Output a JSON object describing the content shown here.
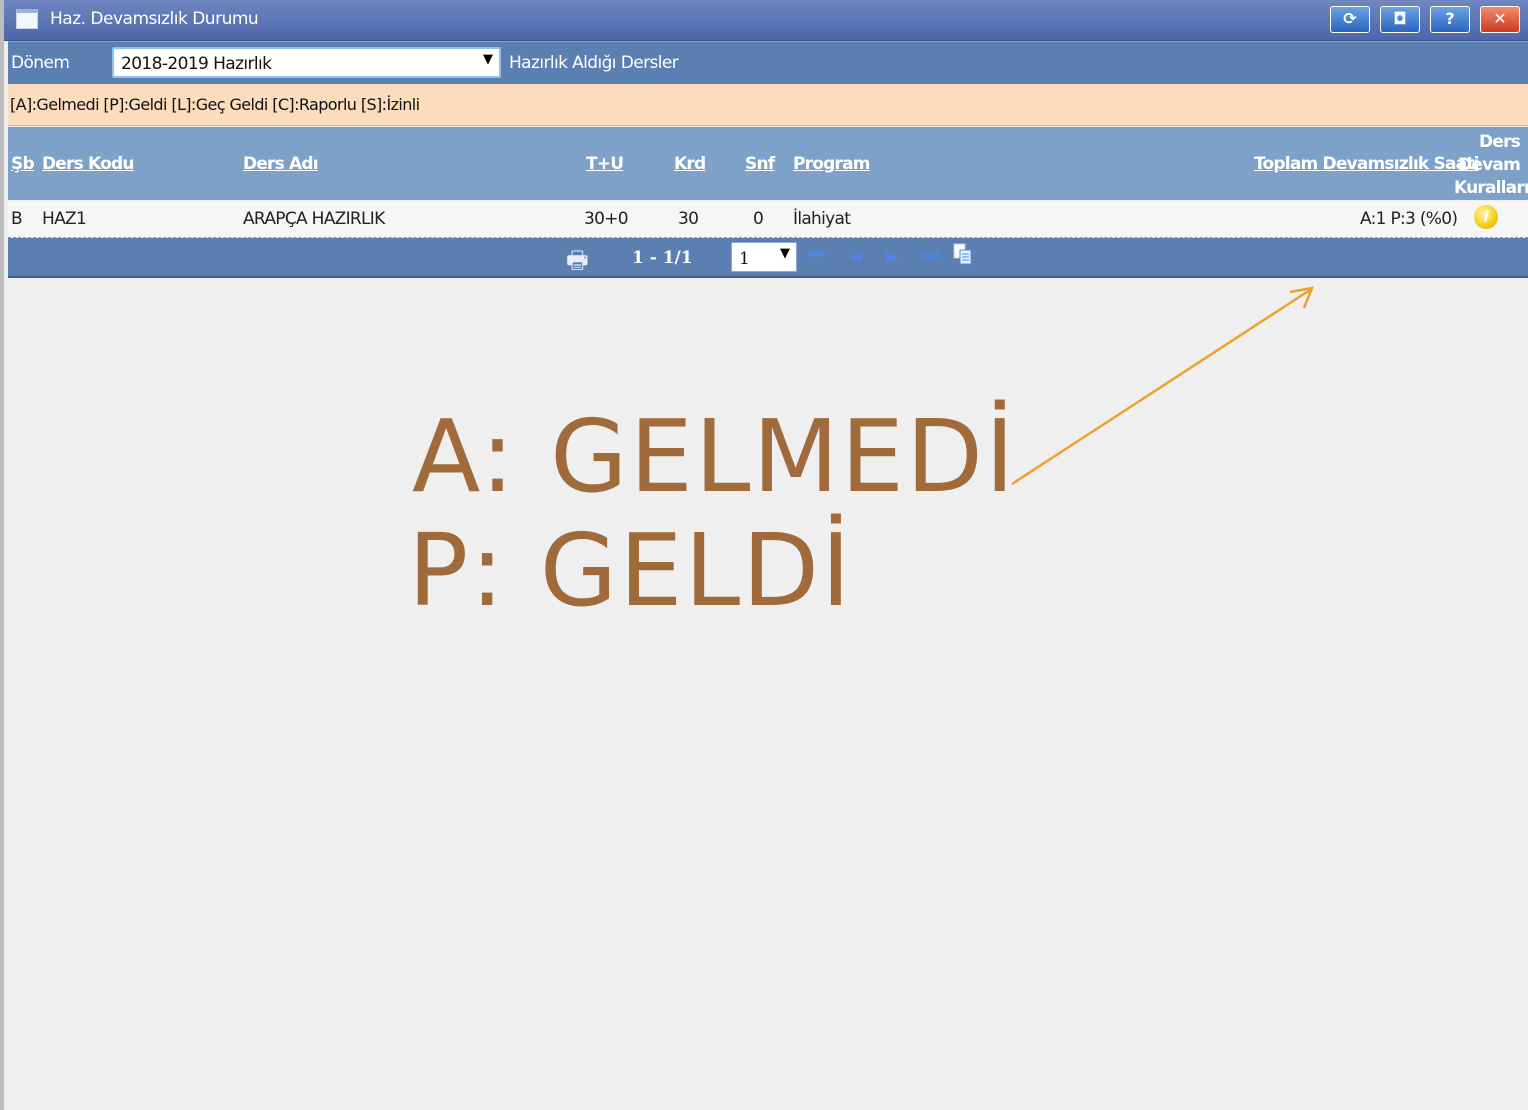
{
  "window": {
    "title": "Haz. Devamsızlık Durumu",
    "buttons": {
      "refresh": "⟳",
      "maximize": "◘",
      "help": "?",
      "close": "✕"
    }
  },
  "toolbar": {
    "term_label": "Dönem",
    "term_value": "2018-2019 Hazırlık",
    "dropdown_arrow": "▼",
    "courses_label": "Hazırlık Aldığı Dersler"
  },
  "legend_text": "[A]:Gelmedi [P]:Geldi [L]:Geç Geldi [C]:Raporlu [S]:İzinli",
  "table": {
    "columns": {
      "sb": "Şb",
      "code": "Ders Kodu",
      "name": "Ders Adı",
      "tu": "T+U",
      "krd": "Krd",
      "snf": "Snf",
      "program": "Program",
      "total": "Toplam Devamsızlık Saati",
      "rules": "Ders Devam Kuralları"
    },
    "rows": [
      {
        "sb": "B",
        "code": "HAZ1",
        "name": "ARAPÇA HAZIRLIK",
        "tu": "30+0",
        "krd": "30",
        "snf": "0",
        "program": "İlahiyat",
        "total": "A:1 P:3 (%0)",
        "rules_icon": "i"
      }
    ]
  },
  "pager": {
    "print_icon": "🖶",
    "range": "1 - 1/1",
    "page_value": "1",
    "dropdown_arrow": "▼",
    "first": "⏮",
    "prev": "◀",
    "next": "▶",
    "last": "⏭"
  },
  "annotation": {
    "line1": "A: GELMEDİ",
    "line2": "P: GELDİ",
    "color": "#a06a3a",
    "arrow_color": "#f0a030"
  }
}
